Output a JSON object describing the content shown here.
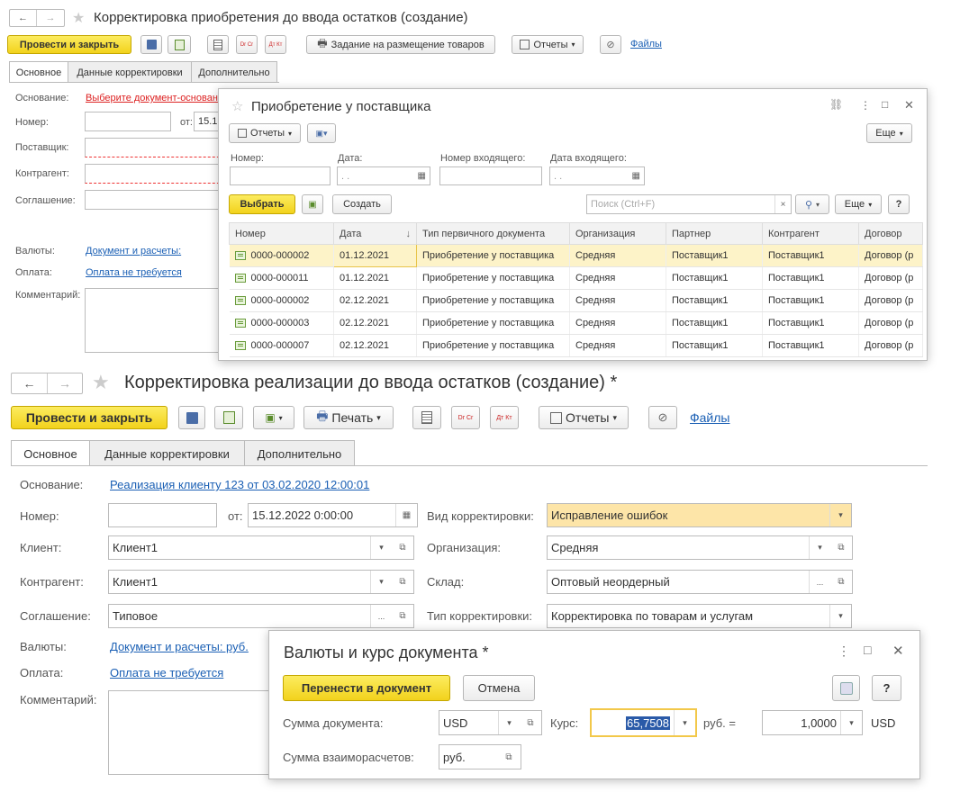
{
  "top": {
    "title": "Корректировка приобретения до ввода остатков (создание)",
    "nav_back": "←",
    "nav_fwd": "→",
    "star": "★",
    "post_close": "Провести и закрыть",
    "task_label": "Задание на размещение товаров",
    "reports_label": "Отчеты",
    "files_label": "Файлы",
    "dt_icon": "Dr Cr",
    "dtkt_icon": "Дт Кт",
    "tabs": [
      "Основное",
      "Данные корректировки",
      "Дополнительно"
    ],
    "labels": {
      "osnovanie": "Основание:",
      "nomer": "Номер:",
      "ot": "от:",
      "date_partial": "15.1",
      "postavshik": "Поставщик:",
      "kontragent": "Контрагент:",
      "soglashenie": "Соглашение:",
      "valuty": "Валюты:",
      "oplata": "Оплата:",
      "comment": "Комментарий:"
    },
    "osnovanie_link": "Выберите документ-основан",
    "valuty_link": "Документ и расчеты:",
    "oplata_link": "Оплата не требуется"
  },
  "purchase_dialog": {
    "title": "Приобретение у поставщика",
    "star": "☆",
    "link_icon": "⛓",
    "more_icon": "⋮",
    "max_icon": "□",
    "close_icon": "✕",
    "reports_label": "Отчеты",
    "more_label": "Еще",
    "filters": {
      "nomer_label": "Номер:",
      "data_label": "Дата:",
      "data_value": ". .",
      "in_num_label": "Номер входящего:",
      "in_date_label": "Дата входящего:",
      "in_date_value": ". ."
    },
    "select_label": "Выбрать",
    "create_label": "Создать",
    "search_placeholder": "Поиск (Ctrl+F)",
    "help_label": "?",
    "clear_label": "×",
    "columns": [
      "Номер",
      "Дата",
      "Тип первичного документа",
      "Организация",
      "Партнер",
      "Контрагент",
      "Договор"
    ],
    "sort_arrow": "↓",
    "rows": [
      [
        "0000-000002",
        "01.12.2021",
        "Приобретение у поставщика",
        "Средняя",
        "Поставщик1",
        "Поставщик1",
        "Договор (р"
      ],
      [
        "0000-000011",
        "01.12.2021",
        "Приобретение у поставщика",
        "Средняя",
        "Поставщик1",
        "Поставщик1",
        "Договор (р"
      ],
      [
        "0000-000002",
        "02.12.2021",
        "Приобретение у поставщика",
        "Средняя",
        "Поставщик1",
        "Поставщик1",
        "Договор (р"
      ],
      [
        "0000-000003",
        "02.12.2021",
        "Приобретение у поставщика",
        "Средняя",
        "Поставщик1",
        "Поставщик1",
        "Договор (р"
      ],
      [
        "0000-000007",
        "02.12.2021",
        "Приобретение у поставщика",
        "Средняя",
        "Поставщик1",
        "Поставщик1",
        "Договор (р"
      ]
    ]
  },
  "bottom": {
    "title": "Корректировка реализации до ввода остатков (создание) *",
    "nav_back": "←",
    "nav_fwd": "→",
    "star": "★",
    "post_close": "Провести и закрыть",
    "print_label": "Печать",
    "reports_label": "Отчеты",
    "files_label": "Файлы",
    "dt_icon": "Dr Cr",
    "dtkt_icon": "Дт Кт",
    "tabs": [
      "Основное",
      "Данные корректировки",
      "Дополнительно"
    ],
    "labels": {
      "osnovanie": "Основание:",
      "nomer": "Номер:",
      "ot": "от:",
      "klient": "Клиент:",
      "kontragent": "Контрагент:",
      "soglashenie": "Соглашение:",
      "valuty": "Валюты:",
      "oplata": "Оплата:",
      "comment": "Комментарий:",
      "vid": "Вид корректировки:",
      "org": "Организация:",
      "sklad": "Склад:",
      "tip": "Тип корректировки:"
    },
    "osnovanie_link": "Реализация клиенту 123 от 03.02.2020 12:00:01",
    "date_value": "15.12.2022  0:00:00",
    "klient_value": "Клиент1",
    "kontragent_value": "Клиент1",
    "soglashenie_value": "Типовое",
    "vid_value": "Исправление ошибок",
    "org_value": "Средняя",
    "sklad_value": "Оптовый неордерный",
    "tip_value": "Корректировка по товарам и услугам",
    "valuty_link": "Документ и расчеты: руб.",
    "oplata_link": "Оплата не требуется"
  },
  "currency_dialog": {
    "title": "Валюты и курс документа *",
    "transfer_label": "Перенести в документ",
    "cancel_label": "Отмена",
    "help_label": "?",
    "sum_doc_label": "Сумма документа:",
    "currency_value": "USD",
    "rate_label": "Курс:",
    "rate_value": "65,7508",
    "rub_eq": "руб. =",
    "amount_value": "1,0000",
    "amount_currency": "USD",
    "sum_settle_label": "Сумма взаиморасчетов:",
    "settle_value": "руб."
  }
}
